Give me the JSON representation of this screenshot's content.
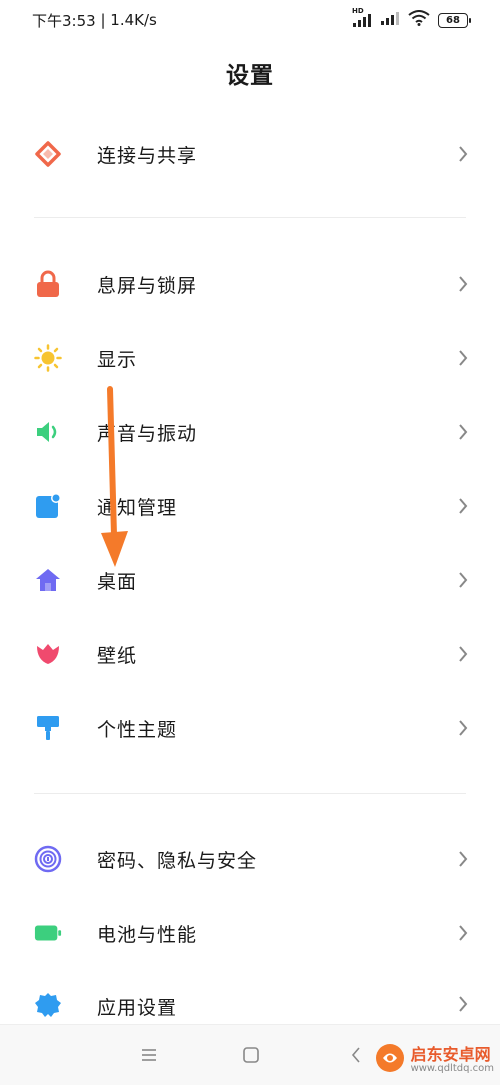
{
  "status_bar": {
    "time": "下午3:53",
    "separator": " | ",
    "speed": "1.4K/s",
    "hd_label": "HD",
    "battery": "68"
  },
  "header": {
    "title": "设置"
  },
  "groups": [
    {
      "items": [
        {
          "label": "连接与共享",
          "icon": "share-diamond-icon"
        }
      ]
    },
    {
      "items": [
        {
          "label": "息屏与锁屏",
          "icon": "lock-icon"
        },
        {
          "label": "显示",
          "icon": "sun-icon"
        },
        {
          "label": "声音与振动",
          "icon": "speaker-icon"
        },
        {
          "label": "通知管理",
          "icon": "notification-icon"
        },
        {
          "label": "桌面",
          "icon": "home-icon"
        },
        {
          "label": "壁纸",
          "icon": "tulip-icon"
        },
        {
          "label": "个性主题",
          "icon": "paint-roller-icon"
        }
      ]
    },
    {
      "items": [
        {
          "label": "密码、隐私与安全",
          "icon": "fingerprint-icon"
        },
        {
          "label": "电池与性能",
          "icon": "battery-icon"
        },
        {
          "label": "应用设置",
          "icon": "gear-icon"
        }
      ]
    }
  ],
  "colors": {
    "share": "#f0684a",
    "lock": "#f0684a",
    "sun": "#f7c431",
    "speaker": "#3ccf7e",
    "notification": "#2f9cf0",
    "home": "#6f6af2",
    "tulip": "#f04a6e",
    "theme": "#2f9cf0",
    "fingerprint": "#6f6af2",
    "battery": "#3ccf7e",
    "gear": "#2f9cf0",
    "arrow": "#f47a2a",
    "chevron": "#888888"
  },
  "watermark": {
    "name": "启东安卓网",
    "url": "www.qdltdq.com"
  }
}
